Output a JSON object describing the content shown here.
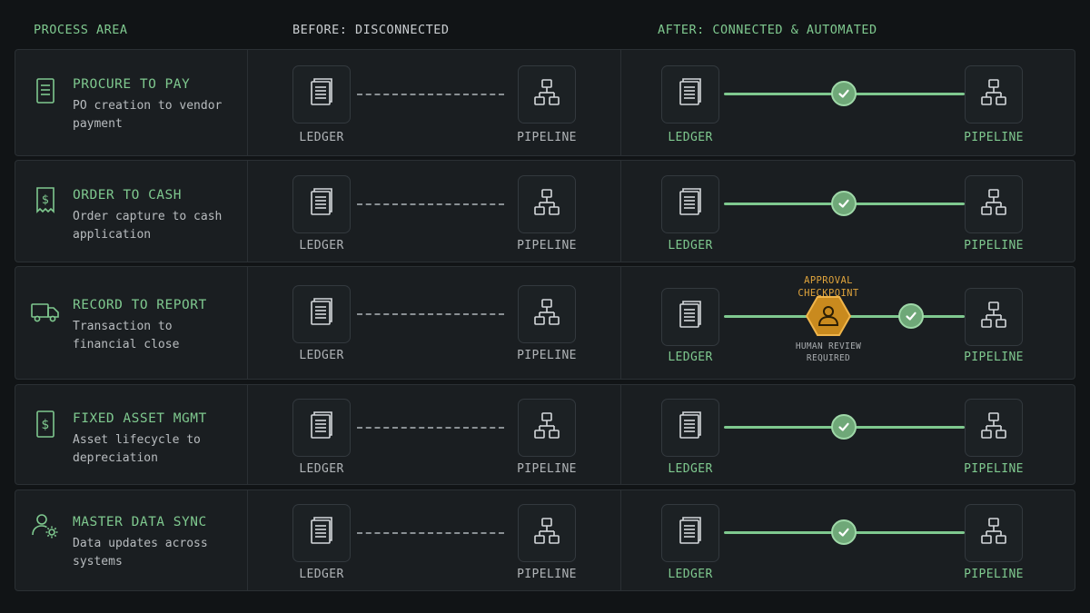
{
  "headers": {
    "process": "PROCESS AREA",
    "before": "BEFORE: DISCONNECTED",
    "after": "AFTER: CONNECTED & AUTOMATED"
  },
  "rows": [
    {
      "icon": "document-icon",
      "title": "PROCURE TO PAY",
      "desc": "PO creation to vendor payment",
      "ledger": "LEDGER",
      "pipeline": "PIPELINE"
    },
    {
      "icon": "receipt-dollar-icon",
      "title": "ORDER TO CASH",
      "desc": "Order capture to cash application",
      "ledger": "LEDGER",
      "pipeline": "PIPELINE"
    },
    {
      "icon": "truck-icon",
      "title": "RECORD TO REPORT",
      "desc": "Transaction to financial close",
      "ledger": "LEDGER",
      "pipeline": "PIPELINE"
    },
    {
      "icon": "dollar-document-icon",
      "title": "FIXED ASSET MGMT",
      "desc": "Asset lifecycle to depreciation",
      "ledger": "LEDGER",
      "pipeline": "PIPELINE"
    },
    {
      "icon": "user-gear-icon",
      "title": "MASTER DATA SYNC",
      "desc": "Data updates across systems",
      "ledger": "LEDGER",
      "pipeline": "PIPELINE"
    }
  ],
  "approval": {
    "title": "APPROVAL CHECKPOINT",
    "note": "HUMAN REVIEW REQUIRED"
  },
  "colors": {
    "accent_green": "#7fc98f",
    "approval_amber": "#e0a43c",
    "background": "#111416"
  }
}
